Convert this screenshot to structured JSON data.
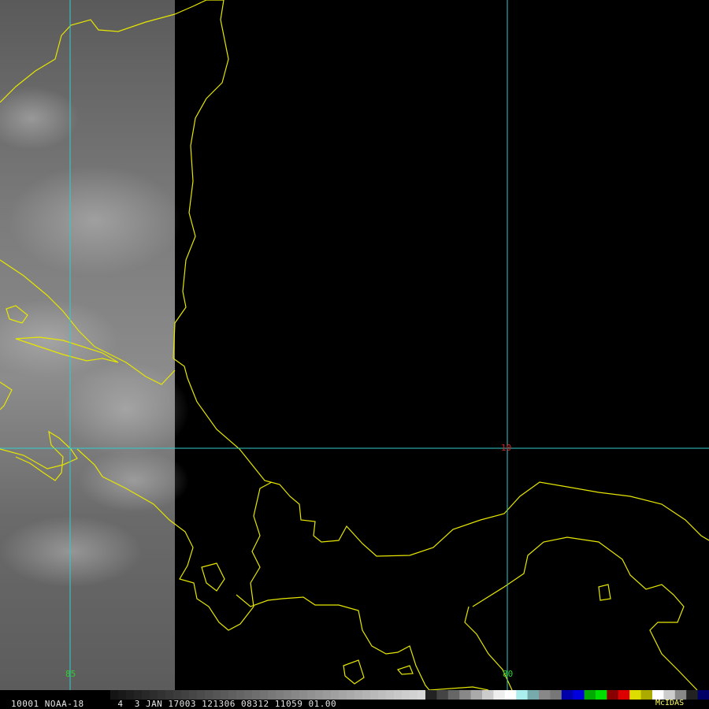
{
  "header": {
    "status_line": "10001 NOAA-18      4  3 JAN 17003 121306 08312 11059 01.00",
    "software": "McIDAS"
  },
  "map": {
    "grid_labels": {
      "lat_10": "10",
      "lon_85": "85",
      "lon_80": "80"
    },
    "colors": {
      "coast": "#e6e600",
      "grid": "#33cccc",
      "lat_label": "#cc2222",
      "lon_label": "#33cc33",
      "background": "#000000"
    }
  },
  "colorbar": {
    "swatches": [
      "#222222",
      "#444444",
      "#666666",
      "#888888",
      "#aaaaaa",
      "#cccccc",
      "#eeeeee",
      "#ffffff",
      "#aaeeee",
      "#77aaaa",
      "#888888",
      "#777777",
      "#0000aa",
      "#0000dd",
      "#00aa00",
      "#00dd00",
      "#880000",
      "#dd0000",
      "#dddd00",
      "#aaaa00",
      "#ffffff",
      "#cccccc",
      "#888888",
      "#222222",
      "#000066"
    ]
  }
}
